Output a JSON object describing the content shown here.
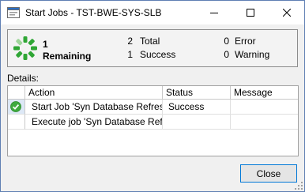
{
  "window": {
    "title": "Start Jobs - TST-BWE-SYS-SLB"
  },
  "summary": {
    "remaining_count": "1",
    "remaining_label": "Remaining",
    "total_count": "2",
    "total_label": "Total",
    "success_count": "1",
    "success_label": "Success",
    "error_count": "0",
    "error_label": "Error",
    "warning_count": "0",
    "warning_label": "Warning"
  },
  "details": {
    "label": "Details:",
    "columns": [
      "Action",
      "Status",
      "Message"
    ],
    "rows": [
      {
        "icon": "success-check-icon",
        "action": "Start Job 'Syn Database Refres...",
        "status": "Success",
        "message": ""
      },
      {
        "icon": "",
        "action": "Execute job 'Syn Database Ref...",
        "status": "",
        "message": ""
      }
    ]
  },
  "buttons": {
    "close_label": "Close"
  },
  "colors": {
    "spinner_green": "#2fa635",
    "spinner_light": "#9fd69b",
    "success_green": "#3eaa3e",
    "button_border": "#0078d7"
  }
}
